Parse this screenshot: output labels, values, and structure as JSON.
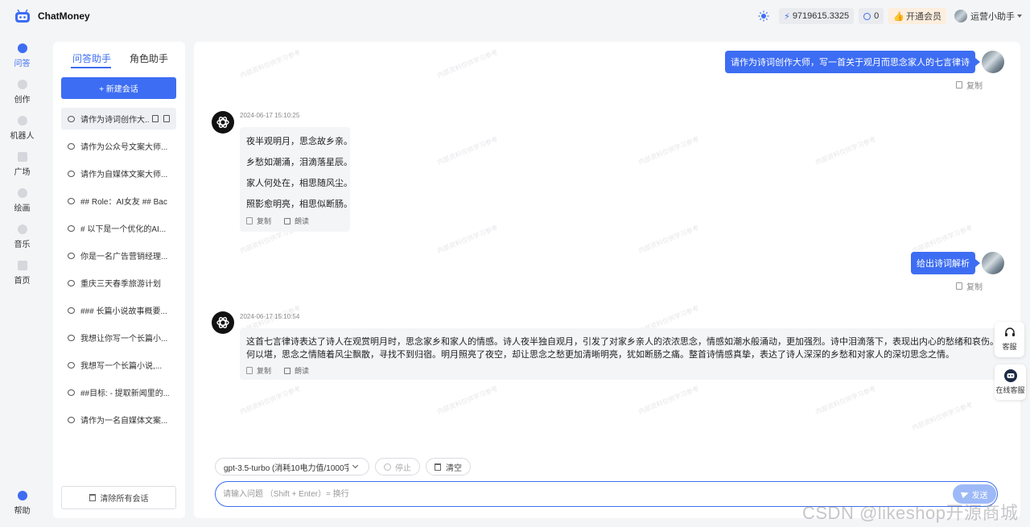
{
  "app": {
    "title": "ChatMoney"
  },
  "topbar": {
    "balance": "9719615.3325",
    "tokens": "0",
    "vip_label": "开通会员",
    "username": "运营小助手"
  },
  "nav": {
    "items": [
      {
        "label": "问答",
        "icon": "chat-icon",
        "active": true
      },
      {
        "label": "创作",
        "icon": "pen-icon"
      },
      {
        "label": "机器人",
        "icon": "robot-icon"
      },
      {
        "label": "广场",
        "icon": "grid-icon"
      },
      {
        "label": "绘画",
        "icon": "palette-icon"
      },
      {
        "label": "音乐",
        "icon": "music-icon"
      },
      {
        "label": "首页",
        "icon": "home-icon"
      }
    ],
    "help": "帮助"
  },
  "sessions": {
    "tabs": [
      "问答助手",
      "角色助手"
    ],
    "new_label": "+ 新建会话",
    "items": [
      "请作为诗词创作大...",
      "请作为公众号文案大师...",
      "请作为自媒体文案大师...",
      "## Role：AI女友 ## Bac",
      "# 以下是一个优化的AI...",
      "你是一名广告营销经理...",
      "重庆三天春季旅游计划",
      "### 长篇小说故事概要...",
      "我想让你写一个长篇小...",
      "我想写一个长篇小说,...",
      "##目标: - 提取新闻里的...",
      "请作为一名自媒体文案..."
    ],
    "clear_label": "清除所有会话"
  },
  "chat": {
    "watermark": "内部资料仅供学习参考",
    "messages": [
      {
        "role": "user",
        "text": "请作为诗词创作大师，写一首关于观月而思念家人的七言律诗",
        "copy": "复制"
      },
      {
        "role": "bot",
        "time": "2024-06-17 15:10:25",
        "lines": [
          "夜半观明月，思念故乡亲。",
          "乡愁如潮涌，泪滴落星辰。",
          "家人何处在，相思随风尘。",
          "照影愈明亮，相思似断肠。"
        ],
        "copy": "复制",
        "read": "朗读"
      },
      {
        "role": "user",
        "text": "给出诗词解析",
        "copy": "复制"
      },
      {
        "role": "bot",
        "time": "2024-06-17 15:10:54",
        "lines": [
          "这首七言律诗表达了诗人在观赏明月时，思念家乡和家人的情感。诗人夜半独自观月，引发了对家乡亲人的浓浓思念，情感如潮水般涌动，更加强烈。诗中泪滴落下，表现出内心的愁绪和哀伤。家人何处，情",
          "何以堪，思念之情随着风尘飘散，寻找不到归宿。明月照亮了夜空，却让思念之愁更加清晰明亮，犹如断肠之痛。整首诗情感真挚，表达了诗人深深的乡愁和对家人的深切思念之情。"
        ],
        "copy": "复制",
        "read": "朗读"
      }
    ]
  },
  "composer": {
    "model": "gpt-3.5-turbo (消耗10电力值/1000字符)",
    "stop": "停止",
    "clear": "清空",
    "placeholder": "请输入问题 （Shift + Enter）= 换行",
    "send": "发送"
  },
  "float": {
    "service": "客服",
    "online_service": "在线客服"
  },
  "footer_watermark": "CSDN @likeshop开源商城",
  "colors": {
    "accent": "#3d6df2",
    "panel": "#ffffff",
    "background": "#f4f5f7"
  }
}
